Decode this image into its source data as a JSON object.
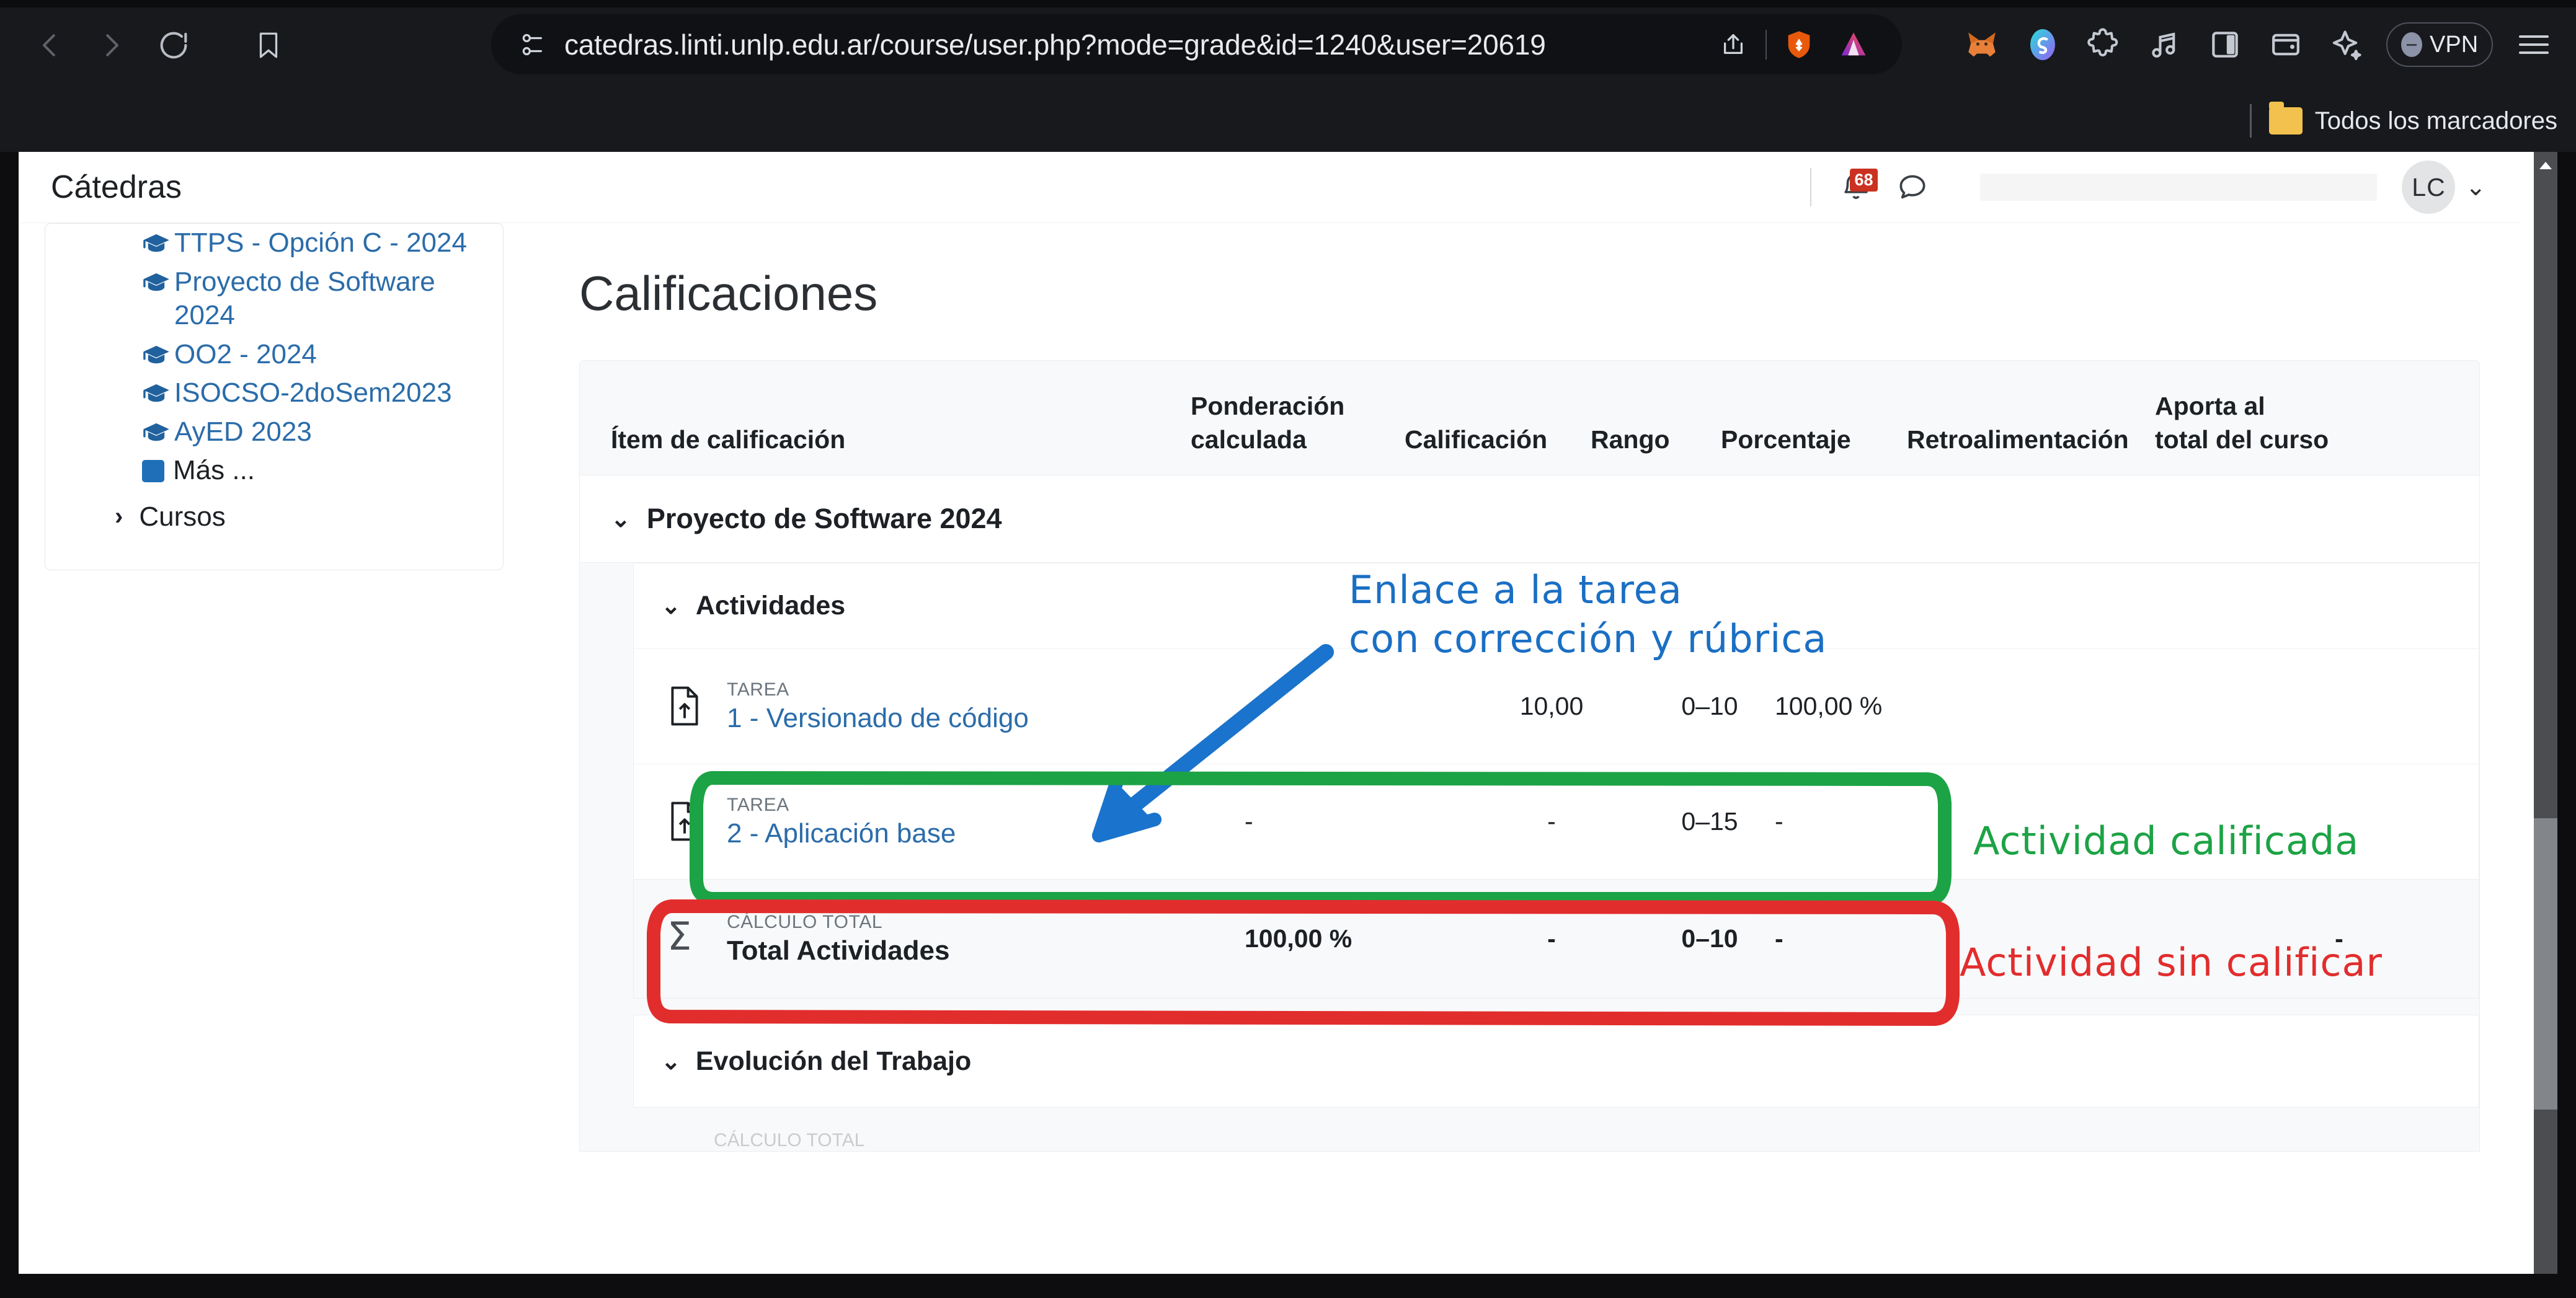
{
  "browser": {
    "url": "catedras.linti.unlp.edu.ar/course/user.php?mode=grade&id=1240&user=20619",
    "back_icon": "back-chevron-icon",
    "forward_icon": "forward-chevron-icon",
    "reload_icon": "reload-icon",
    "bookmark_icon": "bookmark-icon",
    "shield_icon": "brave-shields-icon",
    "share_icon": "share-icon",
    "brave_rewards_icon": "brave-lion-icon",
    "brave_leo_icon": "brave-leo-triangle-icon",
    "extensions": [
      "metamask-fox-icon",
      "sync-extension-icon",
      "puzzle-extensions-icon",
      "brave-playlist-music-icon",
      "sidebar-toggle-icon",
      "brave-wallet-icon",
      "leo-ai-sparkle-icon"
    ],
    "vpn_label": "VPN",
    "menu_icon": "hamburger-menu-icon",
    "bookmarks_bar": {
      "folder_icon": "bookmark-folder-icon",
      "label": "Todos los marcadores"
    }
  },
  "navbar": {
    "site_name": "Cátedras",
    "bell_icon": "notification-bell-icon",
    "bell_badge": "68",
    "messages_icon": "message-bubble-icon",
    "avatar_initials": "LC",
    "avatar_caret": "⌄"
  },
  "sidebar": {
    "courses": [
      {
        "label": "TTPS - Opción C - 2024",
        "icon": "graduation-cap-icon"
      },
      {
        "label": "Proyecto de Software 2024",
        "icon": "graduation-cap-icon"
      },
      {
        "label": "OO2 - 2024",
        "icon": "graduation-cap-icon"
      },
      {
        "label": "ISOCSO-2doSem2023",
        "icon": "graduation-cap-icon"
      },
      {
        "label": "AyED 2023",
        "icon": "graduation-cap-icon"
      }
    ],
    "more_label": "Más ...",
    "more_icon": "square-block-icon",
    "cursos_label": "Cursos",
    "cursos_chevron": "›"
  },
  "main": {
    "page_title": "Calificaciones",
    "table": {
      "headers": {
        "item": "Ítem de calificación",
        "ponderacion_l1": "Ponderación",
        "ponderacion_l2": "calculada",
        "calificacion": "Calificación",
        "rango": "Rango",
        "porcentaje": "Porcentaje",
        "retroalimentacion": "Retroalimentación",
        "aporta_l1": "Aporta al",
        "aporta_l2": "total del curso"
      },
      "course_band": {
        "label": "Proyecto de Software 2024",
        "chevron": "⌄"
      },
      "category": {
        "label": "Actividades",
        "chevron": "⌄"
      },
      "rows": [
        {
          "kind": "TAREA",
          "name": "1 - Versionado de código",
          "icon": "assignment-icon",
          "ponderacion": "-",
          "calificacion": "10,00",
          "rango": "0–10",
          "porcentaje": "100,00 %",
          "retroalimentacion": "",
          "aporta": "",
          "highlight": "green"
        },
        {
          "kind": "TAREA",
          "name": "2 - Aplicación base",
          "icon": "assignment-icon",
          "ponderacion": "-",
          "calificacion": "-",
          "rango": "0–15",
          "porcentaje": "-",
          "retroalimentacion": "",
          "aporta": "",
          "highlight": "red"
        }
      ],
      "total_row": {
        "kind": "CÁLCULO TOTAL",
        "name": "Total Actividades",
        "icon": "sigma-icon",
        "ponderacion": "100,00 %",
        "calificacion": "-",
        "rango": "0–10",
        "porcentaje": "-",
        "retroalimentacion": "",
        "aporta": "-"
      },
      "next_category": {
        "label": "Evolución del Trabajo",
        "chevron": "⌄"
      },
      "tail_partial": "CÁLCULO TOTAL"
    }
  },
  "annotations": [
    {
      "id": "blue-note",
      "text_l1": "Enlace a la tarea",
      "text_l2": "con corrección y rúbrica",
      "color": "#1a6fc4",
      "shape": "arrow"
    },
    {
      "id": "green-note",
      "text": "Actividad calificada",
      "color": "#1ca345",
      "shape": "ellipse-highlight"
    },
    {
      "id": "red-note",
      "text": "Actividad sin calificar",
      "color": "#e22d2d",
      "shape": "ellipse-highlight"
    }
  ],
  "colors": {
    "link": "#2b6ca9",
    "annotation_blue": "#1a6fc4",
    "annotation_green": "#1ca345",
    "annotation_red": "#e22d2d",
    "badge_red": "#ca3120"
  }
}
